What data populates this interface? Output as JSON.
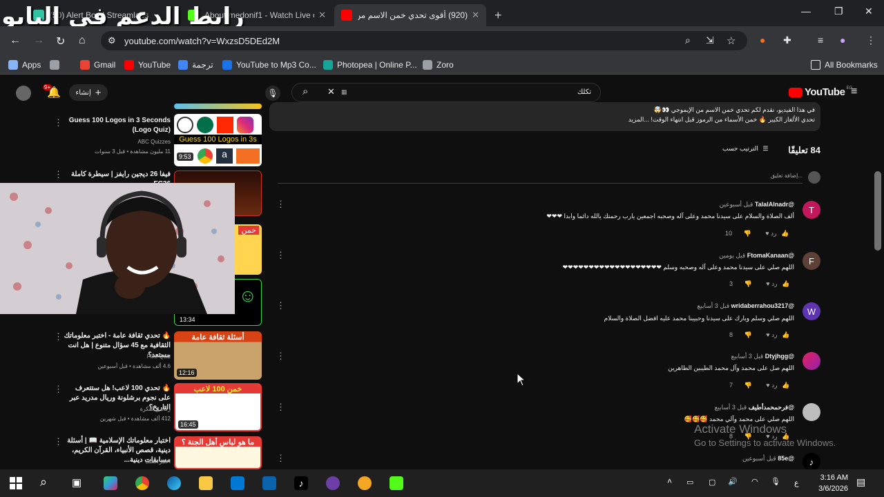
{
  "browser": {
    "tabs": [
      {
        "title": "(50) Alert Box | Streamlabs",
        "favicon_color": "#31c3a2",
        "active": false
      },
      {
        "title": "About medonif1 - Watch Live o",
        "favicon_color": "#53fc18",
        "active": false
      },
      {
        "title": "(920) أقوى تحدي خمن الاسم من ا",
        "favicon_color": "#ff0000",
        "active": true
      }
    ],
    "new_tab": "+",
    "overlay_text": "رابط الدعم في البايو",
    "url": "youtube.com/watch?v=WxzsD5DEd2M",
    "bookmarks": [
      {
        "label": "Apps",
        "color": "#8ab4f8"
      },
      {
        "label": "",
        "color": "#9aa0a6"
      },
      {
        "label": "Gmail",
        "color": "#ea4335"
      },
      {
        "label": "YouTube",
        "color": "#ff0000"
      },
      {
        "label": "ترجمة",
        "color": "#4285f4"
      },
      {
        "label": "YouTube to Mp3 Co...",
        "color": "#1a73e8"
      },
      {
        "label": "Photopea | Online P...",
        "color": "#18a497"
      },
      {
        "label": "Zoro",
        "color": "#9aa0a6"
      }
    ],
    "all_bookmarks": "All Bookmarks"
  },
  "youtube": {
    "create_label": "إنشاء",
    "notif_count": "9+",
    "search_value": "تكلك",
    "logo_text": "YouTube",
    "logo_region": "EG",
    "description_lines": [
      "في هذا الفيديو، نقدم لكم تحدي خمن الاسم من الإيموجي 👀🤯",
      "تحدي الألغاز الكبير 🔥 خمن الأسماء من الرموز قبل انتهاء الوقت! ...المزيد"
    ],
    "comments_count": "84 تعليقًا",
    "sort_label": "الترتيب حسب",
    "add_comment_placeholder": "إضافة تعليق...",
    "comments": [
      {
        "user": "@TalalAlnadr",
        "time": "قبل أسبوعين",
        "text": "ألف الصلاة والسلام على سيدنا محمد وعلى آله وصحبه اجمعين يارب رحمتك يالله دائما وابدا ❤❤❤",
        "likes": "10",
        "reply": "رد",
        "avatar_letter": "T",
        "avatar_color": "#c2185b"
      },
      {
        "user": "@FtomaKanaan",
        "time": "قبل يومين",
        "text": "اللهم صلي على سيدنا محمد وعلى آله وصحبه وسلم ❤❤❤❤❤❤❤❤❤❤❤❤❤❤❤❤❤❤❤",
        "likes": "3",
        "reply": "رد",
        "avatar_letter": "F",
        "avatar_color": "#5d4037"
      },
      {
        "user": "@wridaberrahou3217",
        "time": "قبل 3 أسابيع",
        "text": "اللهم صلي وسلم وبارك على سيدنا وحبيبنا محمد عليه افضل الصلاة والسلام",
        "likes": "8",
        "reply": "رد",
        "avatar_letter": "W",
        "avatar_color": "#5e35b1"
      },
      {
        "user": "@Dtyjhgg",
        "time": "قبل 3 أسابيع",
        "text": "اللهم صل على محمد وآل محمد الطيبين الطاهرين",
        "likes": "7",
        "reply": "رد",
        "avatar_letter": "",
        "avatar_color": "#8e24aa"
      },
      {
        "user": "@فرحمحمدأطيف",
        "time": "قبل 3 أسابيع",
        "text": "اللهم صلي على محمد وآلي محمد 🥰🥰🥰",
        "likes": "8",
        "reply": "رد",
        "avatar_letter": "",
        "avatar_color": "#bdbdbd"
      },
      {
        "user": "@85e",
        "time": "قبل أسبوعين",
        "text": "",
        "likes": "",
        "reply": "",
        "avatar_letter": "",
        "avatar_color": "#000000"
      }
    ],
    "sidebar_videos": [
      {
        "title": "Guess 100 Logos in 3 Seconds (Logo Quiz)",
        "channel": "ABC Quizzes",
        "meta": "11 مليون مشاهدة • قبل 3 سنوات",
        "duration": "9:53",
        "thumb_text": "Guess 100 Logos in 3s"
      },
      {
        "title": "فيفا 26 ديجين رايفز | سيطرة كاملة FC26",
        "channel": "",
        "meta": "",
        "duration": "",
        "thumb_text": ""
      },
      {
        "title": "",
        "channel": "",
        "meta": "",
        "duration": "13:34",
        "thumb_text": "خمن"
      },
      {
        "title": "🔥 تحدي ثقافة عامة - اختبر معلوماتك الثقافية مع 45 سؤال متنوع | هل انت مستعد؟",
        "channel": "Piko Quiz",
        "meta": "4.6 ألف مشاهدة • قبل أسبوعين",
        "duration": "12:16",
        "thumb_text": "أسئلة ثقافة عامة"
      },
      {
        "title": "🔥 تحدي 100 لاعب! هل ستتعرف على نجوم برشلونة وريال مدريد عبر التاريخ؟",
        "channel": "زكاة و الفكرة",
        "meta": "412 ألف مشاهدة • قبل شهرين",
        "duration": "16:45",
        "thumb_text": "خمن 100 لاعب"
      },
      {
        "title": "اختبار معلوماتك الإسلامية 📖 | أسئلة دينية، قصص الأنبياء، القرآن الكريم، مسابقات دينية...",
        "channel": "اختبر عقلك",
        "meta": "",
        "duration": "",
        "thumb_text": "ما هو لباس أهل الجنة ؟"
      }
    ]
  },
  "windows": {
    "watermark_title": "Activate Windows",
    "watermark_sub": "Go to Settings to activate Windows.",
    "time": "3:16 AM",
    "date": "3/6/2026",
    "lang": "ع"
  }
}
